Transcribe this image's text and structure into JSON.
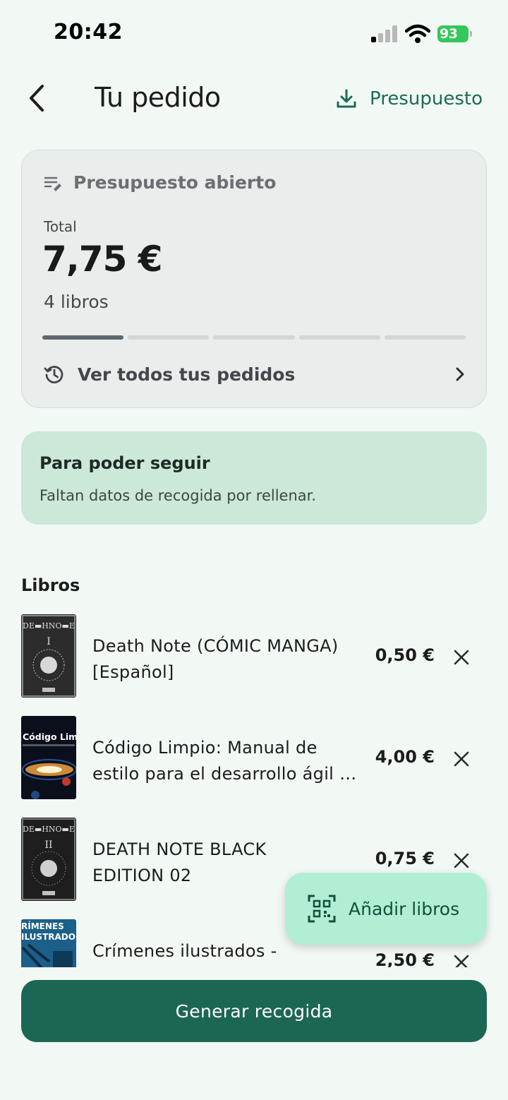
{
  "status_bar": {
    "time": "20:42",
    "battery": "93"
  },
  "header": {
    "title": "Tu pedido",
    "budget_label": "Presupuesto"
  },
  "summary": {
    "status": "Presupuesto abierto",
    "total_label": "Total",
    "total_value": "7,75 €",
    "count": "4 libros",
    "progress_steps": 5,
    "progress_completed": 1,
    "orders_link": "Ver todos tus pedidos"
  },
  "notice": {
    "title": "Para poder seguir",
    "body": "Faltan datos de recogida por rellenar."
  },
  "books": {
    "section_title": "Libros",
    "items": [
      {
        "title_line1": "Death Note (CÓMIC MANGA)",
        "title_line2": "[Español]",
        "price": "0,50 €"
      },
      {
        "title_line1": "Código Limpio: Manual de",
        "title_line2": "estilo para el desarrollo ágil de software",
        "price": "4,00 €"
      },
      {
        "title_line1": "DEATH NOTE BLACK",
        "title_line2": "EDITION 02",
        "price": "0,75 €"
      },
      {
        "title_line1": "Crímenes ilustrados -",
        "title_line2": "",
        "price": "2,50 €"
      }
    ]
  },
  "fab": {
    "label": "Añadir libros",
    "icon": "qr-scan-icon"
  },
  "primary_button": {
    "label": "Generar recogida"
  },
  "colors": {
    "accent": "#1b6753",
    "background": "#f2f9f5",
    "notice": "#cbe8d9",
    "fab": "#b2eed4"
  }
}
